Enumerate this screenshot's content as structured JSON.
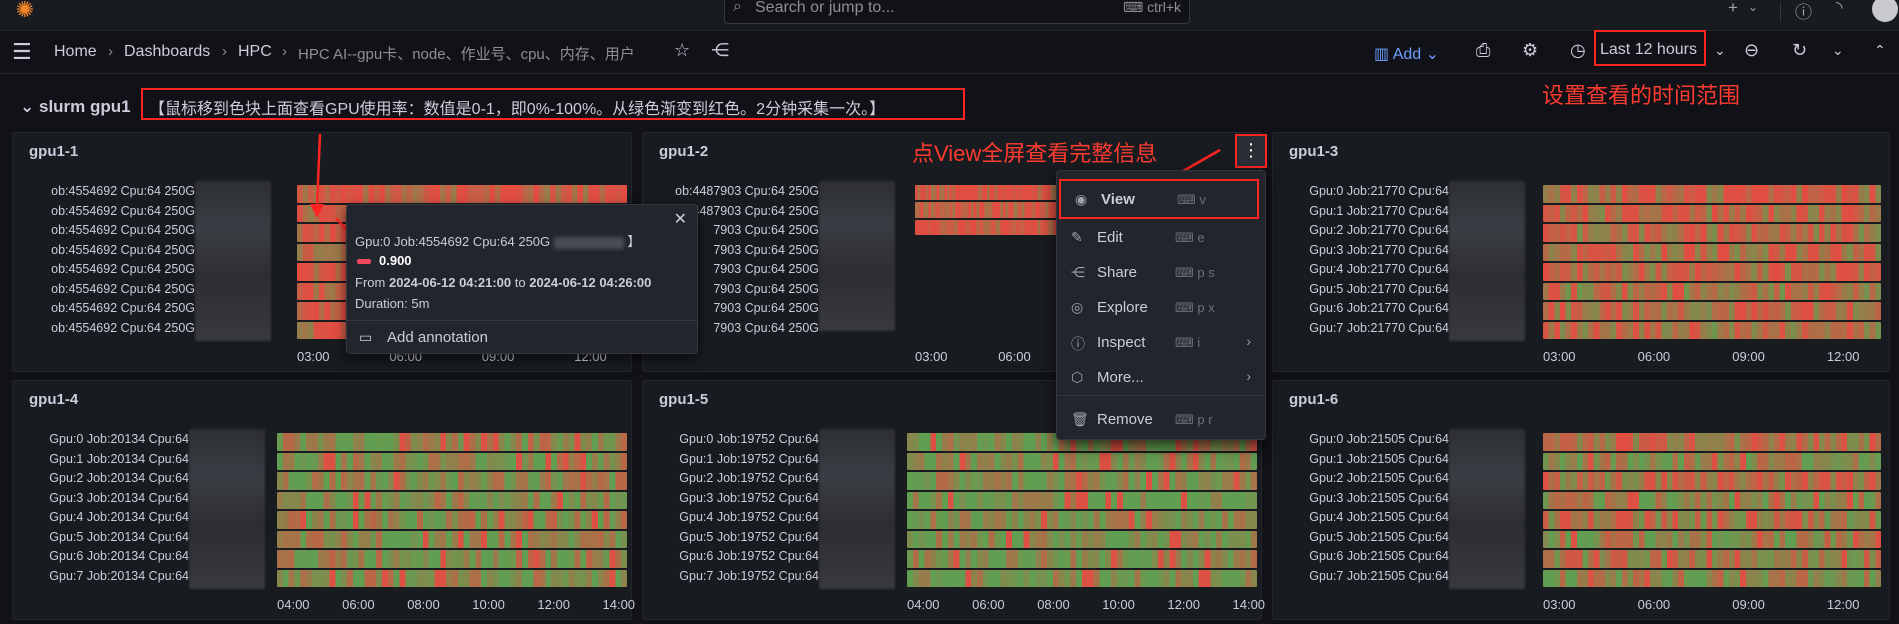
{
  "topbar": {
    "search_placeholder": "Search or jump to...",
    "search_shortcut": "ctrl+k",
    "icons": [
      "grafana-logo-icon",
      "search-icon",
      "plus-icon",
      "chevron-down-icon",
      "help-icon",
      "rss-icon",
      "avatar"
    ]
  },
  "navbar": {
    "breadcrumbs": [
      "Home",
      "Dashboards",
      "HPC",
      "HPC AI--gpu卡、node、作业号、cpu、内存、用户"
    ],
    "add_label": "Add",
    "time_range": "Last 12 hours"
  },
  "annotations": {
    "time_note": "设置查看的时间范围",
    "view_note": "点View全屏查看完整信息"
  },
  "row": {
    "title": "slurm gpu1",
    "note": "【鼠标移到色块上面查看GPU使用率：数值是0-1，即0%-100%。从绿色渐变到红色。2分钟采集一次。】"
  },
  "colors": {
    "green": "#629e51",
    "red": "#e24d42",
    "orange": "#c9743b",
    "bg": "#111217",
    "panel": "#181b1f"
  },
  "panels": [
    {
      "title": "gpu1-1",
      "labels": [
        "ob:4554692 Cpu:64 250G",
        "ob:4554692 Cpu:64 250G",
        "ob:4554692 Cpu:64 250G",
        "ob:4554692 Cpu:64 250G",
        "ob:4554692 Cpu:64 250G",
        "ob:4554692 Cpu:64 250G",
        "ob:4554692 Cpu:64 250G",
        "ob:4554692 Cpu:64 250G"
      ],
      "ticks": [
        "03:00",
        "06:00",
        "09:00",
        "12:00"
      ],
      "heat": [
        0.85,
        0.8,
        0.85,
        0.8,
        0.85,
        0.8,
        0.85,
        0.8
      ]
    },
    {
      "title": "gpu1-2",
      "labels": [
        "ob:4487903 Cpu:64 250G",
        "ob:4487903 Cpu:64 250G",
        "7903 Cpu:64 250G",
        "7903 Cpu:64 250G",
        "7903 Cpu:64 250G",
        "7903 Cpu:64 250G",
        "7903 Cpu:64 250G",
        "7903 Cpu:64 250G"
      ],
      "ticks": [
        "03:00",
        "06:00"
      ],
      "heat": [
        0.9,
        0.9,
        0.9
      ]
    },
    {
      "title": "gpu1-3",
      "labels": [
        "Gpu:0 Job:21770 Cpu:64",
        "Gpu:1 Job:21770 Cpu:64",
        "Gpu:2 Job:21770 Cpu:64",
        "Gpu:3 Job:21770 Cpu:64",
        "Gpu:4 Job:21770 Cpu:64",
        "Gpu:5 Job:21770 Cpu:64",
        "Gpu:6 Job:21770 Cpu:64",
        "Gpu:7 Job:21770 Cpu:64"
      ],
      "ticks": [
        "03:00",
        "06:00",
        "09:00",
        "12:00"
      ],
      "heat": [
        0.7,
        0.65,
        0.6,
        0.65,
        0.6,
        0.55,
        0.6,
        0.55
      ]
    },
    {
      "title": "gpu1-4",
      "labels": [
        "Gpu:0 Job:20134 Cpu:64",
        "Gpu:1 Job:20134 Cpu:64",
        "Gpu:2 Job:20134 Cpu:64",
        "Gpu:3 Job:20134 Cpu:64",
        "Gpu:4 Job:20134 Cpu:64",
        "Gpu:5 Job:20134 Cpu:64",
        "Gpu:6 Job:20134 Cpu:64",
        "Gpu:7 Job:20134 Cpu:64"
      ],
      "ticks": [
        "04:00",
        "06:00",
        "08:00",
        "10:00",
        "12:00",
        "14:00"
      ],
      "heat": [
        0.3,
        0.25,
        0.3,
        0.25,
        0.3,
        0.25,
        0.3,
        0.25
      ]
    },
    {
      "title": "gpu1-5",
      "labels": [
        "Gpu:0 Job:19752 Cpu:64",
        "Gpu:1 Job:19752 Cpu:64",
        "Gpu:2 Job:19752 Cpu:64",
        "Gpu:3 Job:19752 Cpu:64",
        "Gpu:4 Job:19752 Cpu:64",
        "Gpu:5 Job:19752 Cpu:64",
        "Gpu:6 Job:19752 Cpu:64",
        "Gpu:7 Job:19752 Cpu:64"
      ],
      "ticks": [
        "04:00",
        "06:00",
        "08:00",
        "10:00",
        "12:00",
        "14:00"
      ],
      "heat": [
        0.2,
        0.15,
        0.2,
        0.15,
        0.2,
        0.15,
        0.2,
        0.15
      ]
    },
    {
      "title": "gpu1-6",
      "labels": [
        "Gpu:0 Job:21505 Cpu:64",
        "Gpu:1 Job:21505 Cpu:64",
        "Gpu:2 Job:21505 Cpu:64",
        "Gpu:3 Job:21505 Cpu:64",
        "Gpu:4 Job:21505 Cpu:64",
        "Gpu:5 Job:21505 Cpu:64",
        "Gpu:6 Job:21505 Cpu:64",
        "Gpu:7 Job:21505 Cpu:64"
      ],
      "ticks": [
        "03:00",
        "06:00",
        "09:00",
        "12:00"
      ],
      "heat": [
        0.6,
        0.3,
        0.55,
        0.3,
        0.5,
        0.35,
        0.5,
        0.3
      ]
    }
  ],
  "tooltip": {
    "title": "Gpu:0 Job:4554692 Cpu:64 250G",
    "title_tail": "】",
    "value": "0.900",
    "range_from": "From",
    "from_time": "2024-06-12 04:21:00",
    "to_word": "to",
    "to_time": "2024-06-12 04:26:00",
    "duration": "Duration: 5m",
    "annotation": "Add annotation"
  },
  "menu": {
    "items": [
      {
        "label": "View",
        "key": "v",
        "icon": "eye-icon"
      },
      {
        "label": "Edit",
        "key": "e",
        "icon": "edit-icon"
      },
      {
        "label": "Share",
        "key": "p s",
        "icon": "share-icon"
      },
      {
        "label": "Explore",
        "key": "p x",
        "icon": "compass-icon"
      },
      {
        "label": "Inspect",
        "key": "i",
        "icon": "info-icon"
      },
      {
        "label": "More...",
        "key": "",
        "icon": "cube-icon"
      },
      {
        "label": "Remove",
        "key": "p r",
        "icon": "trash-icon"
      }
    ]
  }
}
